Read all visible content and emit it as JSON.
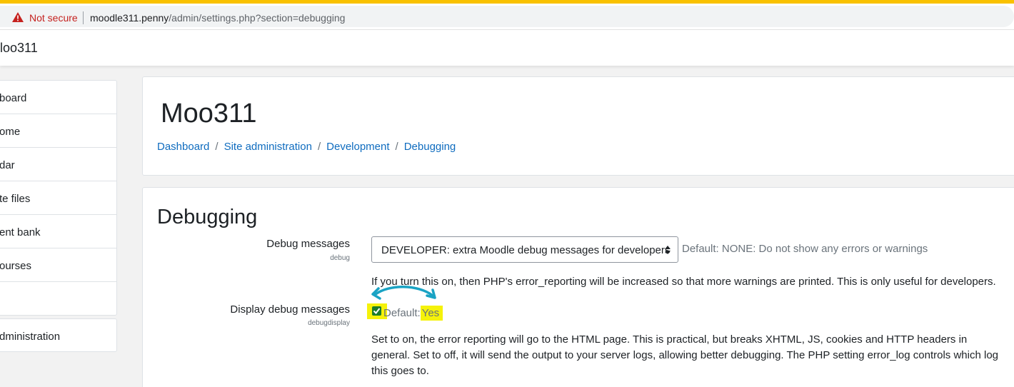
{
  "browser": {
    "security_label": "Not secure",
    "url_host": "moodle311.penny",
    "url_path": "/admin/settings.php?section=debugging"
  },
  "navbar": {
    "site_name": "loo311"
  },
  "sidebar": {
    "items": [
      {
        "label": "board"
      },
      {
        "label": "ome"
      },
      {
        "label": "dar"
      },
      {
        "label": "te files"
      },
      {
        "label": "ent bank"
      },
      {
        "label": "ourses"
      },
      {
        "label": ""
      }
    ],
    "admin_item": {
      "label": "dministration"
    }
  },
  "header": {
    "title": "Moo311",
    "breadcrumb": [
      {
        "label": "Dashboard"
      },
      {
        "label": "Site administration"
      },
      {
        "label": "Development"
      },
      {
        "label": "Debugging"
      }
    ]
  },
  "section": {
    "title": "Debugging",
    "debug_messages": {
      "label": "Debug messages",
      "name": "debug",
      "selected": "DEVELOPER: extra Moodle debug messages for developers",
      "default": "Default: NONE: Do not show any errors or warnings",
      "help": "If you turn this on, then PHP's error_reporting will be increased so that more warnings are printed. This is only useful for developers."
    },
    "display_debug": {
      "label": "Display debug messages",
      "name": "debugdisplay",
      "checked": true,
      "default_prefix": "Default:",
      "default_value": "Yes",
      "help": "Set to on, the error reporting will go to the HTML page. This is practical, but breaks XHTML, JS, cookies and HTTP headers in general. Set to off, it will send the output to your server logs, allowing better debugging. The PHP setting error_log controls which log this goes to."
    }
  },
  "colors": {
    "accent_link": "#0f6cbf",
    "highlight": "#f5f20a",
    "annotation_arrow": "#1aa3c4",
    "warning": "#c5221f",
    "top_stripe": "#f9c100"
  }
}
